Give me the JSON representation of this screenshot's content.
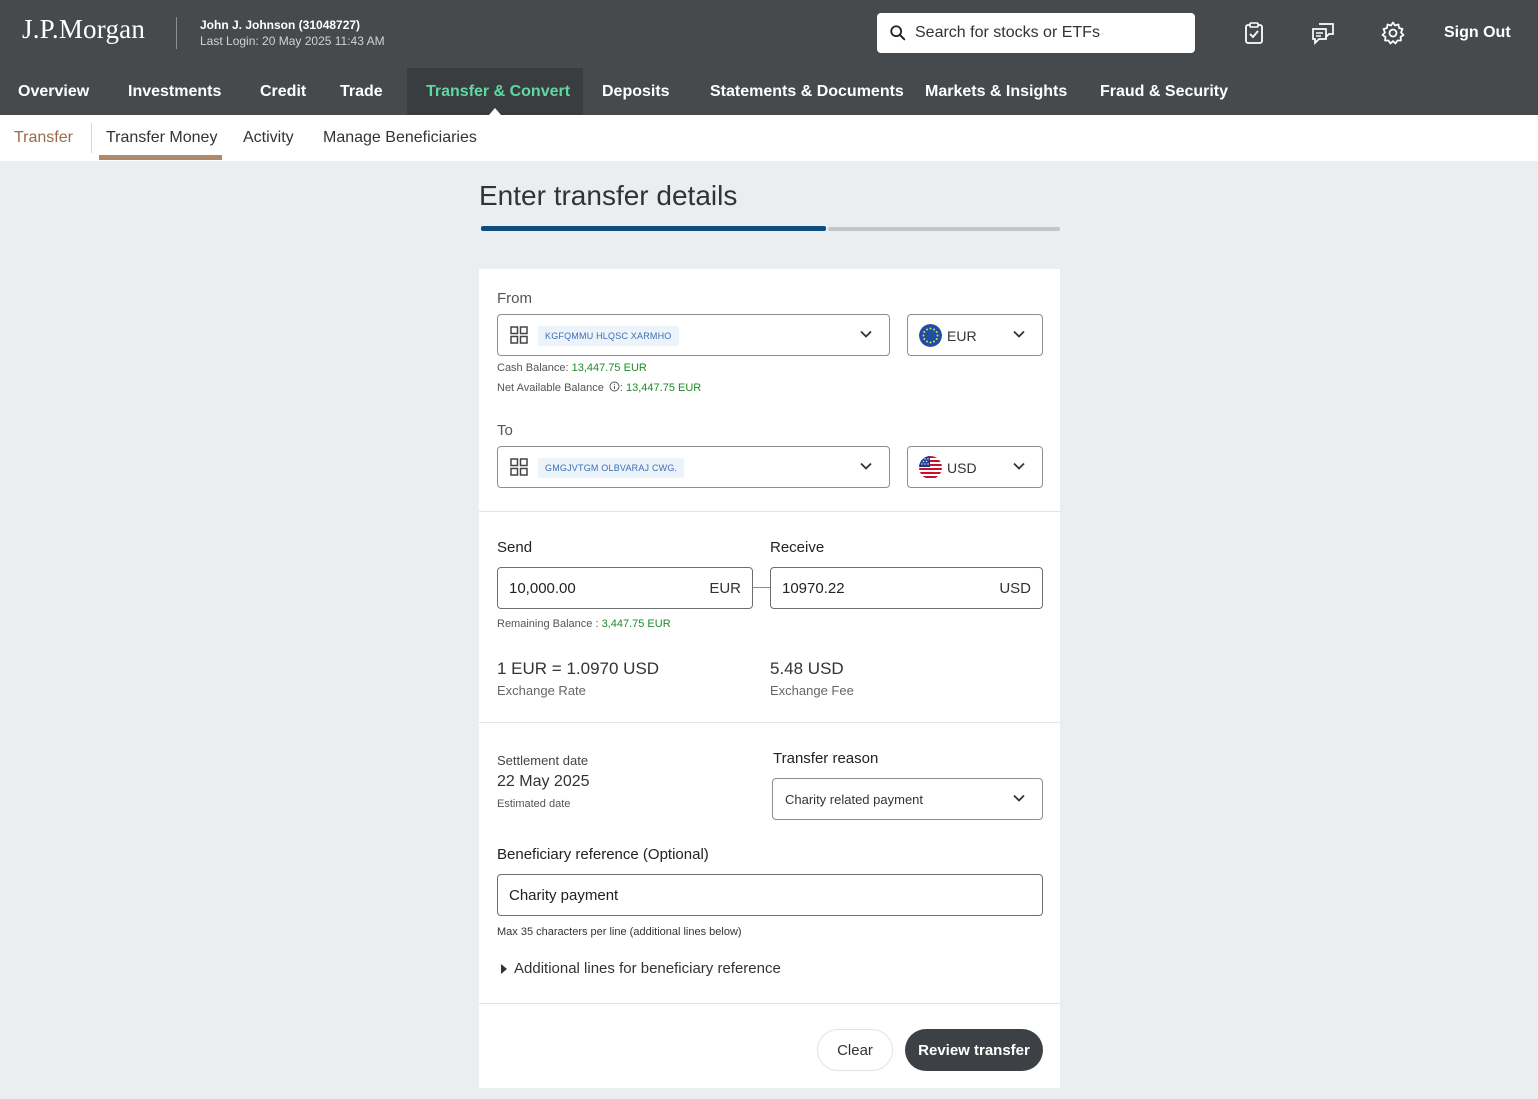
{
  "header": {
    "logo": "J.P.Morgan",
    "user_name": "John J. Johnson (31048727)",
    "last_login": "Last Login: 20 May 2025 11:43 AM",
    "search_placeholder": "Search for stocks or ETFs",
    "icons": [
      "clipboard-check-icon",
      "chat-icon",
      "gear-icon"
    ],
    "sign_out": "Sign Out"
  },
  "main_nav": {
    "items": [
      "Overview",
      "Investments",
      "Credit",
      "Trade",
      "Transfer & Convert",
      "Deposits",
      "Statements & Documents",
      "Markets & Insights",
      "Fraud & Security"
    ],
    "active": "Transfer & Convert",
    "active_color": "#5fd9a2"
  },
  "sub_nav": {
    "root": "Transfer",
    "items": [
      "Transfer Money",
      "Activity",
      "Manage Beneficiaries"
    ],
    "active": "Transfer Money"
  },
  "page": {
    "title": "Enter transfer details",
    "step_progress": 0.5
  },
  "from": {
    "label": "From",
    "account": "KGFQMMU HLQSC XARMHO",
    "currency": "EUR",
    "cash_balance_label": "Cash Balance: ",
    "cash_balance_value": "13,447.75 EUR",
    "net_available_label": "Net Available Balance",
    "net_available_sep": ": ",
    "net_available_value": "13,447.75 EUR"
  },
  "to": {
    "label": "To",
    "account": "GMGJVTGM OLBVARAJ CWG.",
    "currency": "USD"
  },
  "amounts": {
    "send_label": "Send",
    "send_value": "10,000.00",
    "send_unit": "EUR",
    "receive_label": "Receive",
    "receive_value": "10970.22",
    "receive_unit": "USD",
    "remaining_label": "Remaining Balance : ",
    "remaining_value": "3,447.75 EUR",
    "rate_value": "1 EUR = 1.0970 USD",
    "rate_label": "Exchange Rate",
    "fee_value": "5.48 USD",
    "fee_label": "Exchange Fee"
  },
  "details": {
    "settlement_label": "Settlement date",
    "settlement_value": "22 May 2025",
    "settlement_note": "Estimated date",
    "reason_label": "Transfer reason",
    "reason_value": "Charity related payment",
    "ref_label": "Beneficiary reference (Optional)",
    "ref_value": "Charity payment",
    "ref_hint": "Max 35 characters per line (additional lines below)",
    "additional_lines": "Additional lines for beneficiary reference"
  },
  "actions": {
    "clear": "Clear",
    "review": "Review transfer"
  },
  "colors": {
    "header_bg": "#474a4d",
    "accent_underline": "#b0896b",
    "progress": "#0e4d7f",
    "balance_green": "#1f8a2c"
  }
}
